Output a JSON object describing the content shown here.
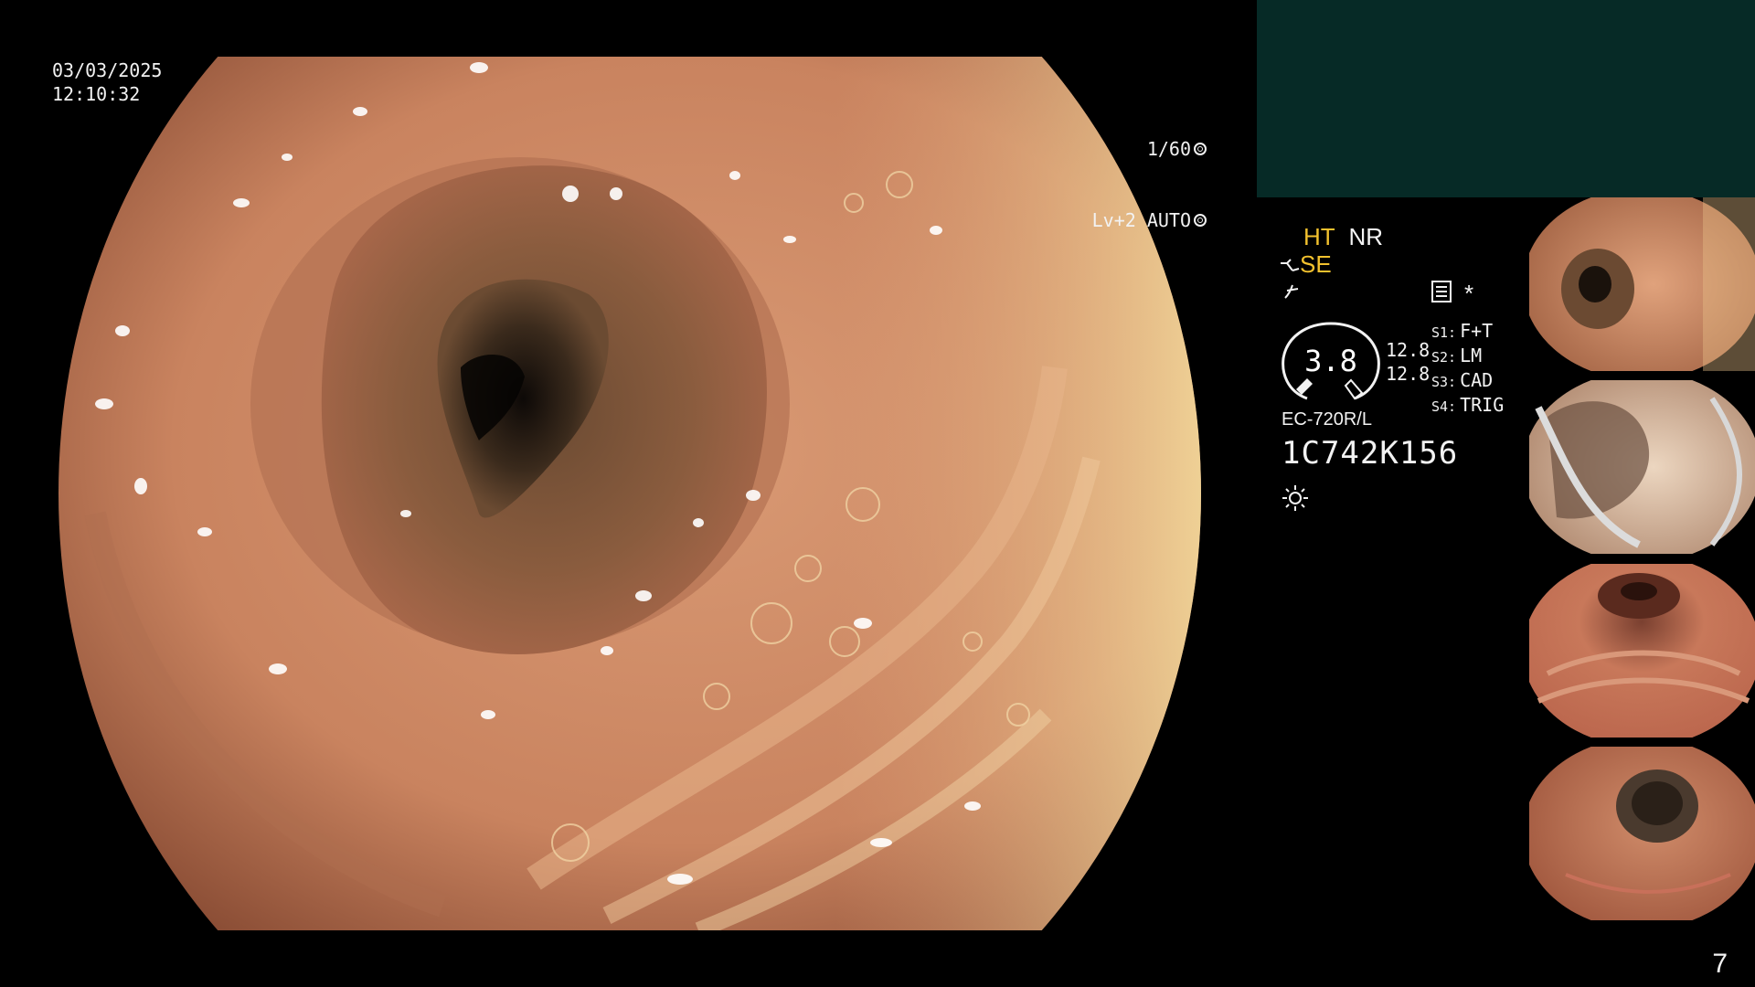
{
  "overlay": {
    "date": "03/03/2025",
    "time": "12:10:32",
    "shutter": "1/60",
    "level_mode": "Lv+2 AUTO"
  },
  "settings": {
    "ht_label": "HT",
    "nr_label": "NR",
    "se_label": "SE",
    "gauge_value": "3.8",
    "readings": [
      "12.8",
      "12.8"
    ],
    "switches": [
      {
        "key": "S1:",
        "value": "F+T"
      },
      {
        "key": "S2:",
        "value": "LM"
      },
      {
        "key": "S3:",
        "value": "CAD"
      },
      {
        "key": "S4:",
        "value": "TRIG"
      }
    ],
    "asterisk": "*",
    "scope_model": "EC-720R/L",
    "scope_serial": "1C742K156"
  },
  "icons": {
    "shutter": "aperture-icon",
    "auto": "ring-icon",
    "structure": "structure-enhance-icon",
    "color": "color-mode-icon",
    "record": "record-icon",
    "light": "light-icon"
  },
  "colors": {
    "accent_yellow": "#f2c12e",
    "panel_teal": "#062a26",
    "mucosa": "#c98766"
  },
  "thumbnails": [
    {
      "name": "capture-1"
    },
    {
      "name": "capture-2"
    },
    {
      "name": "capture-3"
    },
    {
      "name": "capture-4"
    }
  ],
  "page_number": "7"
}
